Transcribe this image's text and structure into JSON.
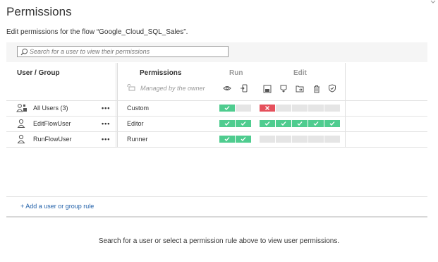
{
  "header": {
    "title": "Permissions",
    "subtitle": "Edit permissions for the flow “Google_Cloud_SQL_Sales”."
  },
  "search": {
    "placeholder": "Search for a user to view their permissions"
  },
  "table": {
    "col_user_group": "User / Group",
    "col_permissions": "Permissions",
    "group_run": "Run",
    "group_edit": "Edit",
    "managed_by_owner": "Managed by the owner",
    "capability_icons": [
      "eye-icon",
      "run-flow-icon",
      "save-icon",
      "download-icon",
      "move-icon",
      "delete-icon",
      "set-permissions-icon"
    ],
    "rows": [
      {
        "name": "All Users (3)",
        "icon": "user-group-icon",
        "more": "•••",
        "role": "Custom",
        "run": [
          "allow",
          "empty"
        ],
        "edit": [
          "deny",
          "empty",
          "empty",
          "empty",
          "empty"
        ]
      },
      {
        "name": "EditFlowUser",
        "icon": "user-icon",
        "more": "•••",
        "role": "Editor",
        "run": [
          "allow",
          "allow"
        ],
        "edit": [
          "allow",
          "allow",
          "allow",
          "allow",
          "allow"
        ]
      },
      {
        "name": "RunFlowUser",
        "icon": "user-icon",
        "more": "•••",
        "role": "Runner",
        "run": [
          "allow",
          "allow"
        ],
        "edit": [
          "empty",
          "empty",
          "empty",
          "empty",
          "empty"
        ]
      }
    ]
  },
  "add_rule": "+ Add a user or group rule",
  "empty_state": "Search for a user or select a permission rule above to view user permissions.",
  "colors": {
    "allow": "#4fcc8f",
    "deny": "#e5505c",
    "empty": "#e5e5e5",
    "link": "#1f5fa8"
  }
}
